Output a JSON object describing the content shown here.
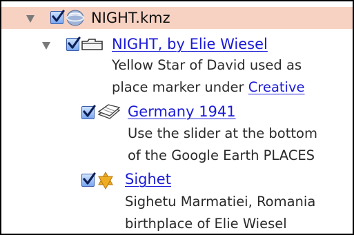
{
  "tree": {
    "root": {
      "label": "NIGHT.kmz",
      "expanded": true,
      "checked": true,
      "selected": true,
      "icon": "globe-icon"
    },
    "folder": {
      "label": "NIGHT, by Elie Wiesel",
      "expanded": true,
      "checked": true,
      "icon": "folder-icon",
      "description": {
        "line1": "Yellow Star of David used as",
        "line2_prefix": "place marker under ",
        "line2_link": "Creative"
      }
    },
    "items": [
      {
        "label": "Germany 1941",
        "checked": true,
        "icon": "image-overlay-icon",
        "description": [
          "Use the slider at the bottom",
          "of the Google Earth PLACES"
        ]
      },
      {
        "label": "Sighet",
        "checked": true,
        "icon": "star-of-david-icon",
        "description": [
          "Sighetu Marmatiei, Romania",
          "birthplace of Elie Wiesel"
        ]
      }
    ]
  },
  "colors": {
    "selected_row": "#f7d2c2",
    "link": "#1a1ad8",
    "checkbox": "#7aa7f0",
    "star": "#e9a21a"
  }
}
